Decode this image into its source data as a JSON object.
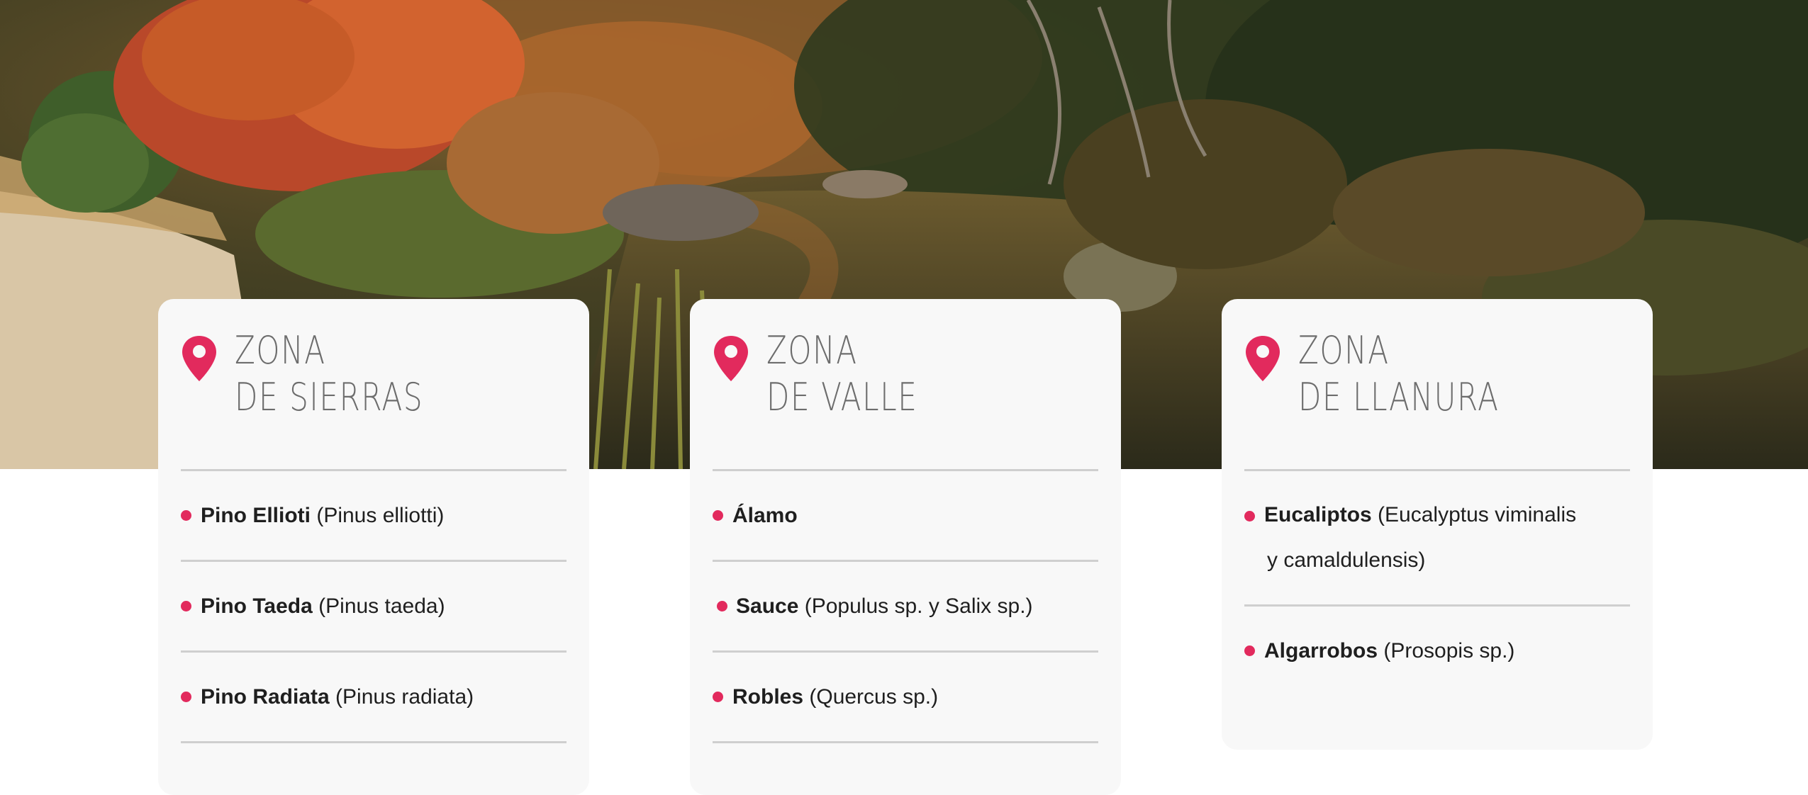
{
  "colors": {
    "accent": "#e22a5d",
    "card_bg": "#f8f8f8",
    "rule": "#cfcfcf"
  },
  "hero": {
    "description_icon": "landscape-photo"
  },
  "zones": [
    {
      "title_line1": "ZONA",
      "title_line2": "DE SIERRAS",
      "items": [
        {
          "name": "Pino Ellioti",
          "sci": " (Pinus elliotti)"
        },
        {
          "name": "Pino Taeda",
          "sci": " (Pinus taeda)"
        },
        {
          "name": "Pino Radiata",
          "sci": " (Pinus radiata)"
        }
      ]
    },
    {
      "title_line1": "ZONA",
      "title_line2": "DE VALLE",
      "items": [
        {
          "name": "Álamo",
          "sci": ""
        },
        {
          "name": "Sauce",
          "sci": " (Populus sp. y Salix sp.)"
        },
        {
          "name": "Robles",
          "sci": " (Quercus sp.)"
        }
      ]
    },
    {
      "title_line1": "ZONA",
      "title_line2": "DE LLANURA",
      "items": [
        {
          "name": "Eucaliptos",
          "sci": " (Eucalyptus viminalis",
          "sci_line2": "y camaldulensis)"
        },
        {
          "name": "Algarrobos",
          "sci": " (Prosopis sp.)"
        }
      ]
    }
  ]
}
